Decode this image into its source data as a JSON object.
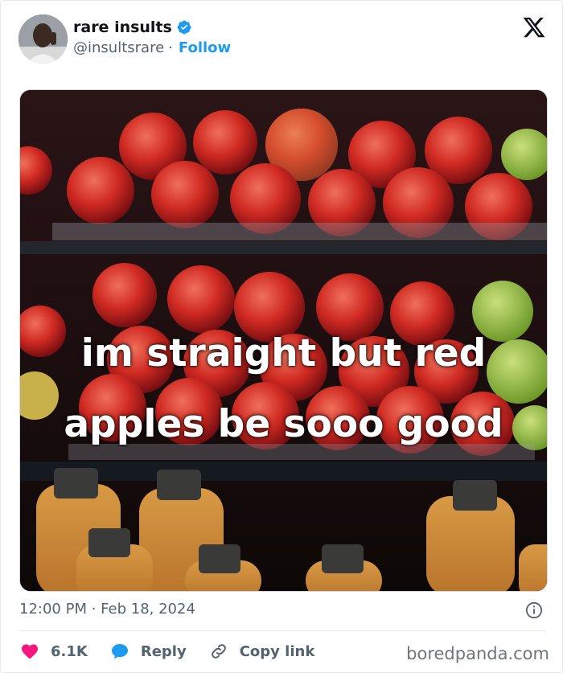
{
  "author": {
    "display_name": "rare insults",
    "handle": "@insultsrare",
    "separator": "·",
    "follow_label": "Follow",
    "verified": true
  },
  "media": {
    "caption_line1": "im straight but red",
    "caption_line2": "apples be sooo good"
  },
  "meta": {
    "timestamp": "12:00 PM · Feb 18, 2024"
  },
  "actions": {
    "likes": "6.1K",
    "reply_label": "Reply",
    "copy_label": "Copy link"
  },
  "watermark": "boredpanda.com",
  "colors": {
    "accent": "#1d9bf0",
    "heart": "#f91880",
    "text_secondary": "#536471"
  }
}
